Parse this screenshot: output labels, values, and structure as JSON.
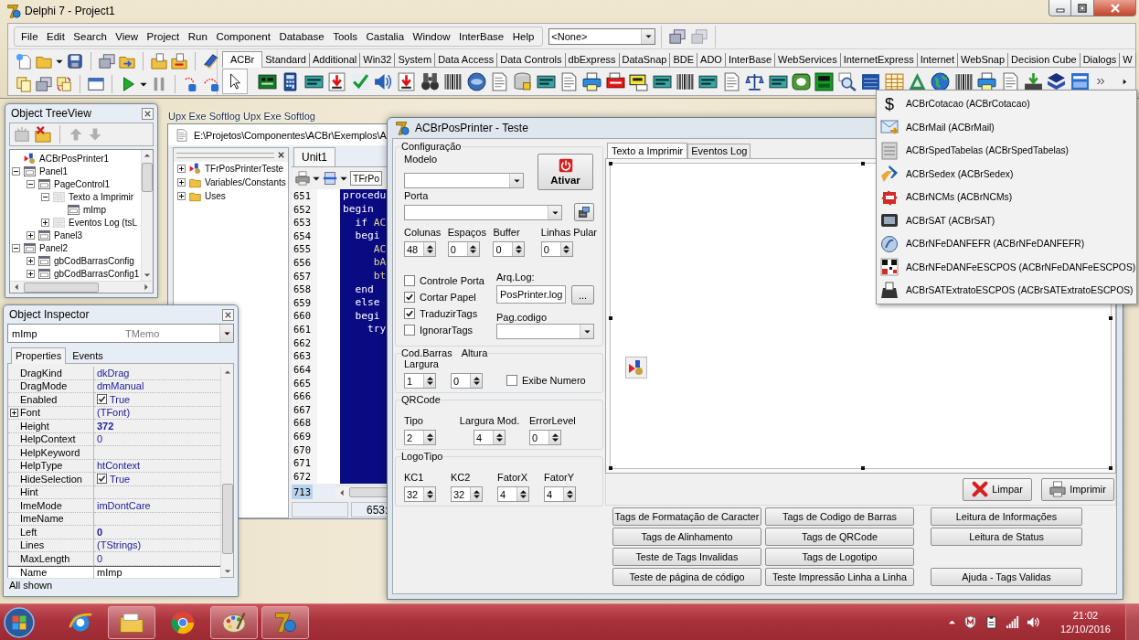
{
  "ide": {
    "title": "Delphi 7 - Project1",
    "menu": [
      "File",
      "Edit",
      "Search",
      "View",
      "Project",
      "Run",
      "Component",
      "Database",
      "Tools",
      "Castalia",
      "Window",
      "InterBase",
      "Help"
    ],
    "desktop_layout": "<None>",
    "palette_tabs": [
      {
        "label": "ACBr",
        "selected": true
      },
      {
        "label": "Standard",
        "selected": false
      },
      {
        "label": "Additional",
        "selected": false
      },
      {
        "label": "Win32",
        "selected": false
      },
      {
        "label": "System",
        "selected": false
      },
      {
        "label": "Data Access",
        "selected": false
      },
      {
        "label": "Data Controls",
        "selected": false
      },
      {
        "label": "dbExpress",
        "selected": false
      },
      {
        "label": "DataSnap",
        "selected": false
      },
      {
        "label": "BDE",
        "selected": false
      },
      {
        "label": "ADO",
        "selected": false
      },
      {
        "label": "InterBase",
        "selected": false
      },
      {
        "label": "WebServices",
        "selected": false
      },
      {
        "label": "InternetExpress",
        "selected": false
      },
      {
        "label": "Internet",
        "selected": false
      },
      {
        "label": "WebSnap",
        "selected": false
      },
      {
        "label": "Decision Cube",
        "selected": false
      },
      {
        "label": "Dialogs",
        "selected": false
      },
      {
        "label": "W",
        "selected": false
      }
    ]
  },
  "desktop_labels": [
    "Upx Exe Softlog",
    "Upx Exe Softlog"
  ],
  "object_treeview": {
    "title": "Object TreeView",
    "nodes": [
      {
        "label": "ACBrPosPrinter1",
        "kind": "component"
      },
      {
        "label": "Panel1",
        "kind": "control",
        "expanded": true,
        "children": [
          {
            "label": "PageControl1",
            "kind": "control",
            "expanded": true,
            "children": [
              {
                "label": "Texto a Imprimir",
                "kind": "page",
                "expanded": true,
                "children": [
                  {
                    "label": "mImp",
                    "kind": "control"
                  }
                ]
              },
              {
                "label": "Eventos Log (tsL",
                "kind": "page",
                "expanded": false
              }
            ]
          },
          {
            "label": "Panel3",
            "kind": "control",
            "expanded": false
          }
        ]
      },
      {
        "label": "Panel2",
        "kind": "control",
        "expanded": true,
        "children": [
          {
            "label": "gbCodBarrasConfig",
            "kind": "control",
            "expanded": false
          },
          {
            "label": "gbCodBarrasConfig1",
            "kind": "control",
            "expanded": false
          }
        ]
      }
    ]
  },
  "object_inspector": {
    "title": "Object Inspector",
    "component_name": "mImp",
    "component_type": "TMemo",
    "tabs": [
      {
        "label": "Properties",
        "selected": true
      },
      {
        "label": "Events",
        "selected": false
      }
    ],
    "properties": [
      {
        "name": "DragKind",
        "value": "dkDrag",
        "kind": "text",
        "modified": false,
        "selected": false
      },
      {
        "name": "DragMode",
        "value": "dmManual",
        "kind": "text",
        "modified": false,
        "selected": false
      },
      {
        "name": "Enabled",
        "value": "True",
        "kind": "checkbox",
        "checked": true,
        "modified": false,
        "selected": false
      },
      {
        "name": "Font",
        "value": "(TFont)",
        "kind": "text",
        "expanded": false,
        "modified": false,
        "selected": false
      },
      {
        "name": "Height",
        "value": "372",
        "kind": "text",
        "modified": true,
        "selected": false
      },
      {
        "name": "HelpContext",
        "value": "0",
        "kind": "text",
        "modified": false,
        "selected": false
      },
      {
        "name": "HelpKeyword",
        "kind": "text",
        "selected": false
      },
      {
        "name": "HelpType",
        "value": "htContext",
        "kind": "text",
        "modified": false,
        "selected": false
      },
      {
        "name": "HideSelection",
        "value": "True",
        "kind": "checkbox",
        "checked": true,
        "modified": false,
        "selected": false
      },
      {
        "name": "Hint",
        "kind": "text",
        "selected": false
      },
      {
        "name": "ImeMode",
        "value": "imDontCare",
        "kind": "text",
        "modified": false,
        "selected": false
      },
      {
        "name": "ImeName",
        "kind": "text",
        "selected": false
      },
      {
        "name": "Left",
        "value": "0",
        "kind": "text",
        "modified": true,
        "selected": false
      },
      {
        "name": "Lines",
        "value": "(TStrings)",
        "kind": "text",
        "modified": false,
        "selected": false
      },
      {
        "name": "MaxLength",
        "value": "0",
        "kind": "text",
        "modified": false,
        "selected": false
      },
      {
        "name": "Name",
        "value": "mImp",
        "kind": "text",
        "modified": false,
        "selected": true
      }
    ],
    "status": "All shown"
  },
  "code_editor": {
    "path": "E:\\Projetos\\Componentes\\ACBr\\Exemplos\\A",
    "explorer": [
      {
        "label": "TFrPosPrinterTeste",
        "kind": "class",
        "expanded": false
      },
      {
        "label": "Variables/Constants",
        "kind": "folder",
        "expanded": false
      },
      {
        "label": "Uses",
        "kind": "folder",
        "expanded": false
      }
    ],
    "tabs": [
      {
        "label": "Unit1",
        "selected": true
      }
    ],
    "class_combo": "TFrPo",
    "lines": [
      {
        "number": "651",
        "tokens": [
          {
            "text": "procedu",
            "kind": "keyword"
          }
        ]
      },
      {
        "number": "652",
        "tokens": [
          {
            "text": "begin",
            "kind": "keyword"
          }
        ]
      },
      {
        "number": "653",
        "tokens": [
          {
            "text": "  if ",
            "kind": "keyword"
          },
          {
            "text": "AC",
            "kind": "identifier"
          }
        ]
      },
      {
        "number": "654",
        "tokens": [
          {
            "text": "  begi",
            "kind": "keyword"
          }
        ]
      },
      {
        "number": "655",
        "tokens": [
          {
            "text": "     AC",
            "kind": "identifier"
          }
        ]
      },
      {
        "number": "656",
        "tokens": [
          {
            "text": "     bA",
            "kind": "identifier"
          }
        ]
      },
      {
        "number": "657",
        "tokens": [
          {
            "text": "     bt",
            "kind": "identifier"
          }
        ]
      },
      {
        "number": "658",
        "tokens": [
          {
            "text": "  end",
            "kind": "keyword"
          }
        ]
      },
      {
        "number": "659",
        "tokens": [
          {
            "text": "  else",
            "kind": "keyword"
          }
        ]
      },
      {
        "number": "660",
        "tokens": [
          {
            "text": "  begi",
            "kind": "keyword"
          }
        ]
      },
      {
        "number": "661",
        "tokens": [
          {
            "text": "    try",
            "kind": "keyword"
          }
        ]
      },
      {
        "number": "662"
      },
      {
        "number": "663"
      },
      {
        "number": "664"
      },
      {
        "number": "665"
      },
      {
        "number": "666"
      },
      {
        "number": "667"
      },
      {
        "number": "668"
      },
      {
        "number": "669"
      },
      {
        "number": "670"
      },
      {
        "number": "671"
      },
      {
        "number": "672"
      }
    ],
    "current_line": "713",
    "cursor_position": "653:"
  },
  "dialog": {
    "title": "ACBrPosPrinter - Teste",
    "config": {
      "title": "Configuração",
      "model_label": "Modelo",
      "activate_button": "Ativar",
      "port_label": "Porta",
      "spinners": [
        {
          "label": "Colunas",
          "value": "48"
        },
        {
          "label": "Espaços",
          "value": "0"
        },
        {
          "label": "Buffer",
          "value": "0"
        },
        {
          "label": "Linhas Pular",
          "value": "0"
        }
      ],
      "checkboxes": [
        {
          "label": "Controle Porta",
          "checked": false
        },
        {
          "label": "Cortar Papel",
          "checked": true
        },
        {
          "label": "TraduzirTags",
          "checked": true
        },
        {
          "label": "IgnorarTags",
          "checked": false
        }
      ],
      "log_label": "Arq.Log:",
      "log_value": "PosPrinter.log",
      "browse_button": "...",
      "codepage_label": "Pag.codigo"
    },
    "barcode": {
      "title": "Cod.Barras",
      "height_label": "Altura",
      "width_label": "Largura",
      "width_value": "1",
      "height_value": "0",
      "show_number": {
        "label": "Exibe Numero",
        "checked": false
      }
    },
    "qrcode": {
      "title": "QRCode",
      "spinners": [
        {
          "label": "Tipo",
          "value": "2"
        },
        {
          "label": "Largura Mod.",
          "value": "4"
        },
        {
          "label": "ErrorLevel",
          "value": "0"
        }
      ]
    },
    "logo": {
      "title": "LogoTipo",
      "spinners": [
        {
          "label": "KC1",
          "value": "32"
        },
        {
          "label": "KC2",
          "value": "32"
        },
        {
          "label": "FatorX",
          "value": "4"
        },
        {
          "label": "FatorY",
          "value": "4"
        }
      ]
    },
    "tabs": [
      {
        "label": "Texto a Imprimir",
        "selected": true
      },
      {
        "label": "Eventos Log",
        "selected": false
      }
    ],
    "action_buttons": [
      {
        "label": "Limpar",
        "kind": "clear"
      },
      {
        "label": "Imprimir",
        "kind": "print"
      }
    ],
    "test_columns": [
      [
        "Tags de Formatação de Caracter",
        "Tags de Alinhamento",
        "Teste de Tags Invalidas",
        "Teste de página de código"
      ],
      [
        "Tags de Codigo de Barras",
        "Tags de QRCode",
        "Tags de Logotipo",
        "Teste Impressão Linha a Linha"
      ],
      [
        "Leitura de Informações",
        "Leitura de Status"
      ]
    ],
    "help_button": "Ajuda - Tags Validas"
  },
  "component_menu": [
    {
      "label": "ACBrCotacao (ACBrCotacao)",
      "kind": "symbol",
      "symbol": "$"
    },
    {
      "label": "ACBrMail (ACBrMail)",
      "kind": "mail"
    },
    {
      "label": "ACBrSpedTabelas (ACBrSpedTabelas)",
      "kind": "tables"
    },
    {
      "label": "ACBrSedex (ACBrSedex)",
      "kind": "sedex"
    },
    {
      "label": "ACBrNCMs (ACBrNCMs)",
      "kind": "puzzle"
    },
    {
      "label": "ACBrSAT (ACBrSAT)",
      "kind": "chip"
    },
    {
      "label": "ACBrNFeDANFEFR (ACBrNFeDANFEFR)",
      "kind": "seal"
    },
    {
      "label": "ACBrNFeDANFeESCPOS (ACBrNFeDANFeESCPOS)",
      "kind": "qr"
    },
    {
      "label": "ACBrSATExtratoESCPOS (ACBrSATExtratoESCPOS)",
      "kind": "printer"
    }
  ],
  "taskbar": {
    "buttons": [
      {
        "kind": "browser",
        "open": false
      },
      {
        "kind": "folder",
        "open": true
      },
      {
        "kind": "chrome",
        "open": false
      },
      {
        "kind": "paint",
        "open": true
      },
      {
        "kind": "delphi",
        "open": true
      }
    ],
    "time": "21:02",
    "date": "12/10/2016"
  }
}
